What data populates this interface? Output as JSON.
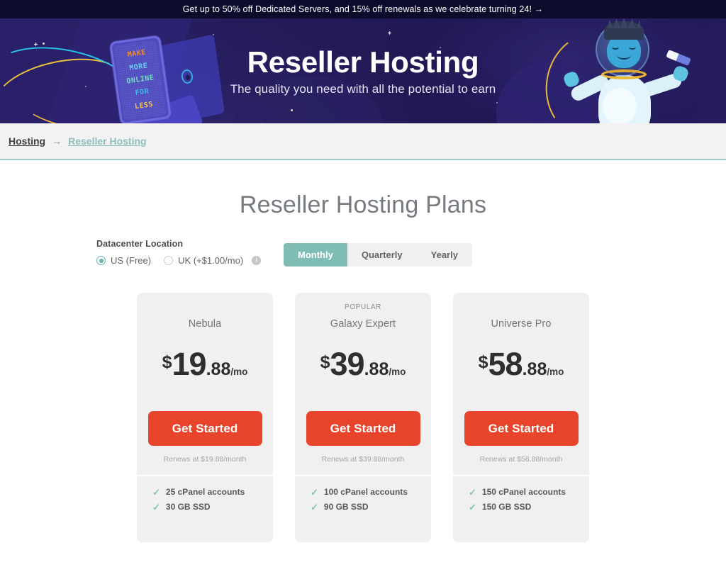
{
  "promo": {
    "text": "Get up to 50% off Dedicated Servers, and 15% off renewals as we celebrate turning 24! →"
  },
  "hero": {
    "title": "Reseller Hosting",
    "subtitle": "The quality you need with all the potential to earn",
    "billboard_lines": [
      "MAKE",
      "MORE",
      "ONLINE",
      "FOR",
      "LESS"
    ],
    "mascot_icon": "astronaut-yeti-icon"
  },
  "breadcrumb": {
    "root": "Hosting",
    "separator": "→",
    "current": "Reseller Hosting"
  },
  "page": {
    "title": "Reseller Hosting Plans"
  },
  "datacenter": {
    "label": "Datacenter Location",
    "options": [
      {
        "label": "US (Free)",
        "selected": true
      },
      {
        "label": "UK (+$1.00/mo)",
        "selected": false
      }
    ],
    "info_icon": "info-icon",
    "info_glyph": "i"
  },
  "billing": {
    "tabs": [
      {
        "label": "Monthly",
        "active": true
      },
      {
        "label": "Quarterly",
        "active": false
      },
      {
        "label": "Yearly",
        "active": false
      }
    ]
  },
  "plans": [
    {
      "badge": "",
      "name": "Nebula",
      "currency": "$",
      "whole": "19",
      "cents": ".88",
      "period": "/mo",
      "cta": "Get Started",
      "renewal": "Renews at $19.88/month",
      "features": [
        "25 cPanel accounts",
        "30 GB SSD"
      ]
    },
    {
      "badge": "POPULAR",
      "name": "Galaxy Expert",
      "currency": "$",
      "whole": "39",
      "cents": ".88",
      "period": "/mo",
      "cta": "Get Started",
      "renewal": "Renews at $39.88/month",
      "features": [
        "100 cPanel accounts",
        "90 GB SSD"
      ]
    },
    {
      "badge": "",
      "name": "Universe Pro",
      "currency": "$",
      "whole": "58",
      "cents": ".88",
      "period": "/mo",
      "cta": "Get Started",
      "renewal": "Renews at $58.88/month",
      "features": [
        "150 cPanel accounts",
        "150 GB SSD"
      ]
    }
  ],
  "colors": {
    "accent_teal": "#7fbdb4",
    "cta_orange": "#e8442b",
    "card_bg": "#f0f0f0",
    "hero_bg": "#231a57",
    "promo_bg": "#0e0c2c",
    "check_teal": "#7fc2ba"
  }
}
